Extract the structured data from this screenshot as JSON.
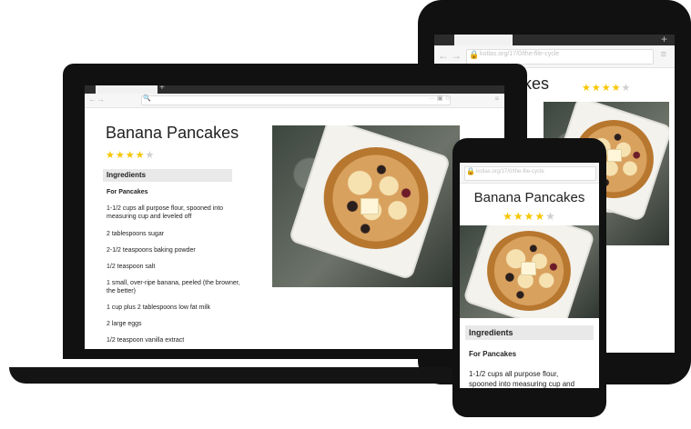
{
  "tablet": {
    "url": "kotlas.org/17/0/the-file-cycle",
    "title": "akes",
    "stars": [
      "★",
      "★",
      "★",
      "★",
      "★"
    ]
  },
  "laptop": {
    "title": "Banana Pancakes",
    "stars": [
      "★",
      "★",
      "★",
      "★",
      "★"
    ],
    "ingredients_label": "Ingredients",
    "subhead": "For Pancakes",
    "items": [
      "1-1/2 cups all purpose flour, spooned into measuring cup and leveled off",
      "2 tablespoons sugar",
      "2-1/2 teaspoons baking powder",
      "1/2 teaspoon salt",
      "1 small, over-ripe banana, peeled (the browner, the better)",
      "1 cup plus 2 tablespoons low fat milk",
      "2 large eggs",
      "1/2 teaspoon vanilla extract"
    ],
    "url": ""
  },
  "phone": {
    "url": "kotlas.org/17/0/the-file-cycle",
    "title": "Banana Pancakes",
    "stars": [
      "★",
      "★",
      "★",
      "★",
      "★"
    ],
    "ingredients_label": "Ingredients",
    "subhead": "For Pancakes",
    "first_item": "1-1/2 cups all purpose flour,",
    "second_line": "spooned into measuring cup and"
  },
  "colors": {
    "device": "#111111",
    "star_on": "#f7c600",
    "star_off": "#cfcfcf",
    "ingredients_bg": "#e9e9e9"
  },
  "ratings": {
    "tablet_stars_on": 4,
    "laptop_stars_on": 4,
    "phone_stars_on": 4,
    "stars_total": 5
  }
}
